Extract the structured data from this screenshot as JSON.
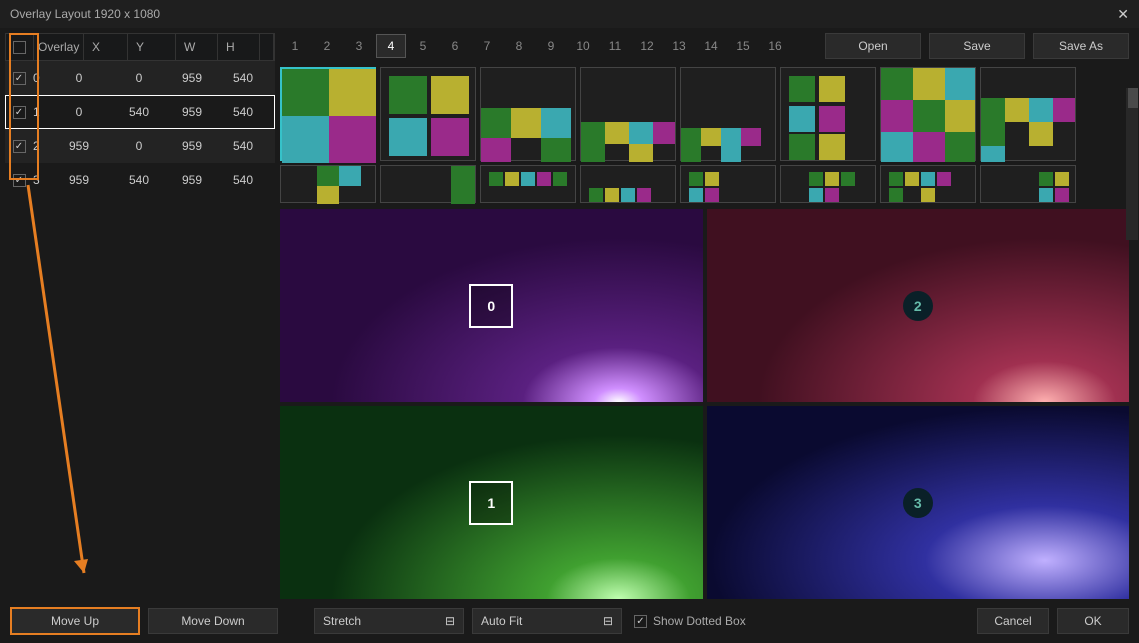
{
  "title": "Overlay Layout 1920 x 1080",
  "tableHeaders": {
    "overlay": "Overlay",
    "x": "X",
    "y": "Y",
    "w": "W",
    "h": "H"
  },
  "rows": [
    {
      "idx": "0",
      "x": "0",
      "y": "0",
      "w": "959",
      "h": "540",
      "checked": true,
      "alt": true,
      "selected": false
    },
    {
      "idx": "1",
      "x": "0",
      "y": "540",
      "w": "959",
      "h": "540",
      "checked": true,
      "alt": false,
      "selected": true
    },
    {
      "idx": "2",
      "x": "959",
      "y": "0",
      "w": "959",
      "h": "540",
      "checked": true,
      "alt": true,
      "selected": false
    },
    {
      "idx": "3",
      "x": "959",
      "y": "540",
      "w": "959",
      "h": "540",
      "checked": true,
      "alt": false,
      "selected": false
    }
  ],
  "tabs": [
    "1",
    "2",
    "3",
    "4",
    "5",
    "6",
    "7",
    "8",
    "9",
    "10",
    "11",
    "12",
    "13",
    "14",
    "15",
    "16"
  ],
  "activeTab": "4",
  "buttons": {
    "open": "Open",
    "save": "Save",
    "saveAs": "Save As",
    "moveUp": "Move Up",
    "moveDown": "Move Down",
    "cancel": "Cancel",
    "ok": "OK"
  },
  "dropdowns": {
    "stretch": "Stretch",
    "autoFit": "Auto Fit"
  },
  "checkbox": {
    "showDotted": "Show Dotted Box"
  },
  "previewLabels": [
    "0",
    "2",
    "1",
    "3"
  ]
}
